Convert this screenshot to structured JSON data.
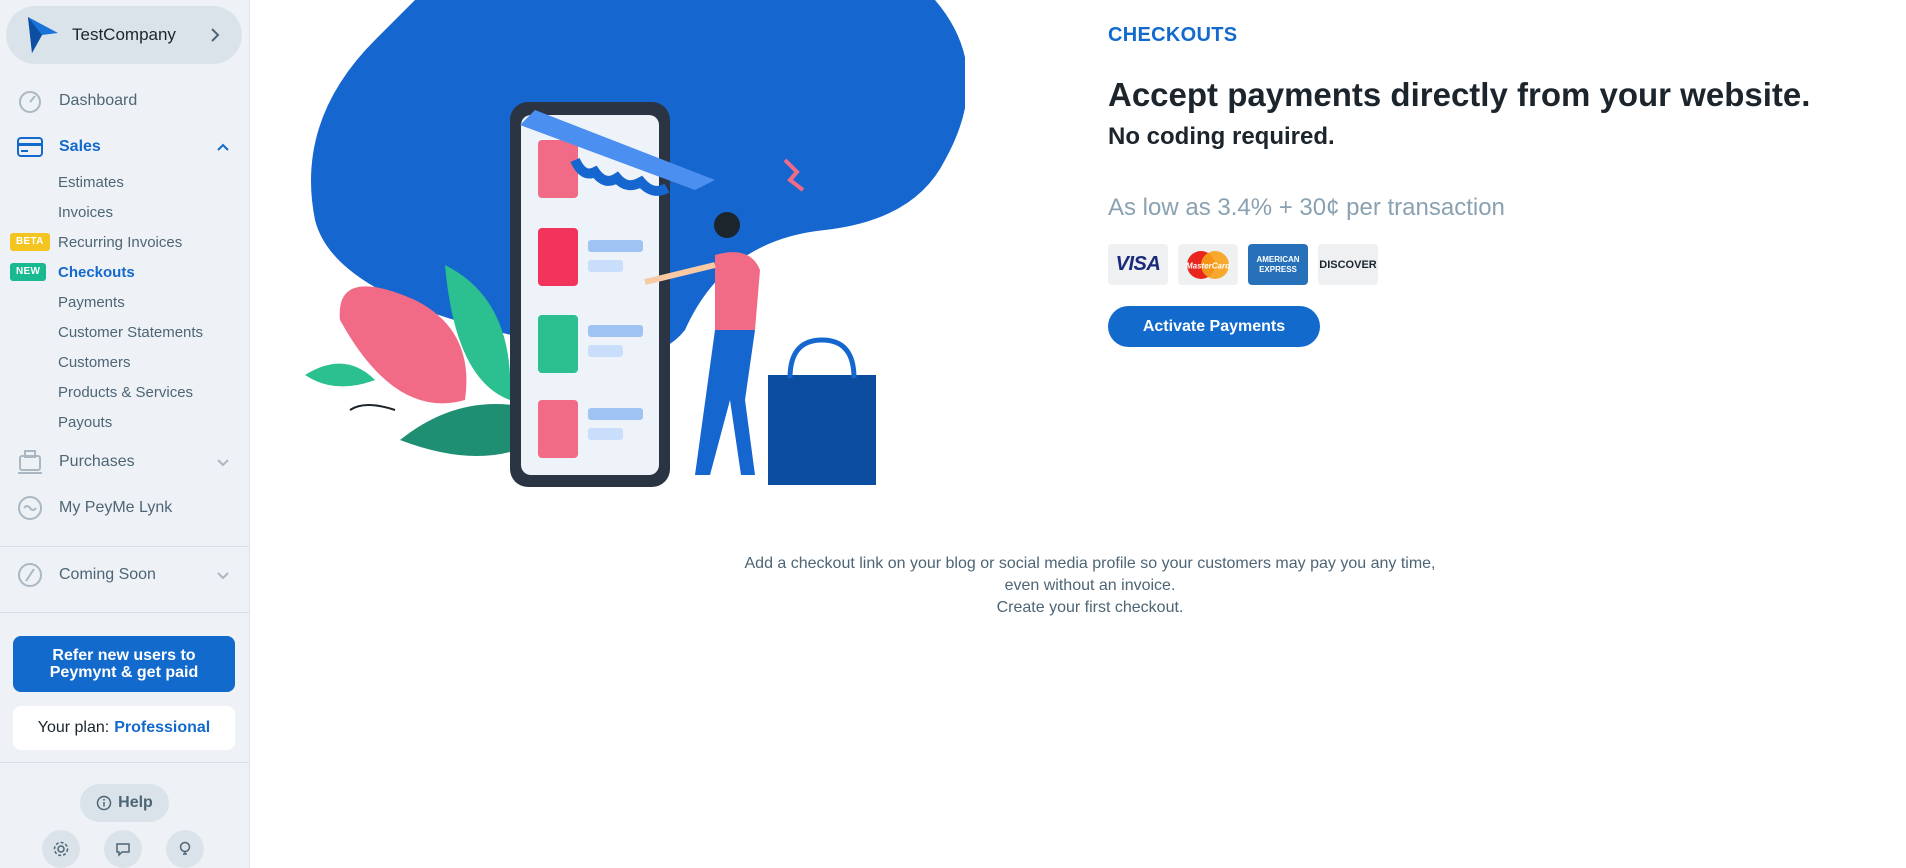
{
  "sidebar": {
    "company_name": "TestCompany",
    "nav": {
      "dashboard": "Dashboard",
      "sales": "Sales",
      "purchases": "Purchases",
      "peyme_lynk": "My PeyMe Lynk",
      "coming_soon": "Coming Soon"
    },
    "sales_items": {
      "estimates": "Estimates",
      "invoices": "Invoices",
      "recurring_invoices": "Recurring Invoices",
      "checkouts": "Checkouts",
      "payments": "Payments",
      "customer_statements": "Customer Statements",
      "customers": "Customers",
      "products_services": "Products & Services",
      "payouts": "Payouts"
    },
    "badges": {
      "beta": "BETA",
      "new": "NEW"
    },
    "refer_button": "Refer new users to Peymynt & get paid",
    "plan_label": "Your plan:",
    "plan_name": "Professional",
    "help_label": "Help",
    "active_color": "#136acd"
  },
  "main": {
    "section_label": "CHECKOUTS",
    "headline": "Accept payments directly from your website.",
    "subheadline": "No coding required.",
    "pricing": "As low as 3.4% + 30¢ per transaction",
    "cards": {
      "visa": "VISA",
      "mastercard": "MasterCard",
      "amex_line1": "AMERICAN",
      "amex_line2": "EXPRESS",
      "discover": "DISCOVER"
    },
    "activate_button": "Activate Payments",
    "description": {
      "line1": "Add a checkout link on your blog or social media profile so your customers may pay you any time,",
      "line2": "even without an invoice.",
      "line3": "Create your first checkout."
    }
  }
}
